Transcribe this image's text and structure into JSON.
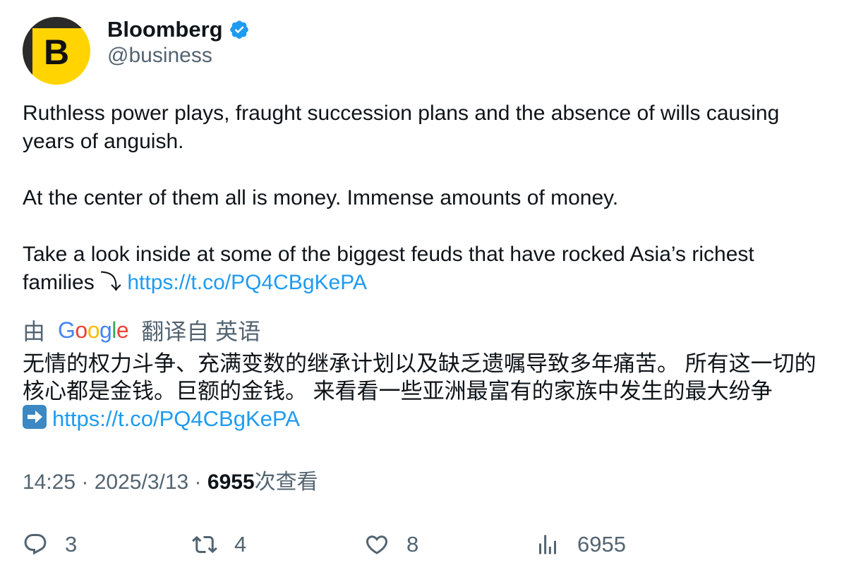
{
  "author": {
    "display_name": "Bloomberg",
    "handle": "@business",
    "avatar_letter": "B",
    "verified": true
  },
  "tweet": {
    "paragraph_1": "Ruthless power plays, fraught succession plans and the absence of wills causing years of anguish.",
    "paragraph_2": "At the center of them all is money. Immense amounts of money.",
    "paragraph_3": "Take a look inside at some of the biggest feuds that have rocked Asia’s richest families ⤵",
    "link": "https://t.co/PQ4CBgKePA"
  },
  "translation": {
    "prefix": "由",
    "provider": "Google",
    "suffix": "翻译自 英语",
    "text": "无情的权力斗争、充满变数的继承计划以及缺乏遗嘱导致多年痛苦。 所有这一切的核心都是金钱。巨额的金钱。 来看看一些亚洲最富有的家族中发生的最大纷争",
    "link": "https://t.co/PQ4CBgKePA"
  },
  "meta": {
    "time": "14:25",
    "date": "2025/3/13",
    "views_count": "6955",
    "views_label": "次查看",
    "separator": " · "
  },
  "actions": {
    "replies": "3",
    "retweets": "4",
    "likes": "8",
    "views": "6955"
  },
  "colors": {
    "link": "#1d9bf0",
    "secondary_text": "#536471",
    "primary_text": "#0f1419",
    "avatar_bg": "#ffd400",
    "verified": "#1d9bf0"
  },
  "icons": {
    "verified": "verified-badge-icon",
    "reply": "reply-icon",
    "retweet": "retweet-icon",
    "like": "heart-icon",
    "views": "bar-chart-icon",
    "arrow_emoji": "right-arrow-emoji-icon"
  }
}
